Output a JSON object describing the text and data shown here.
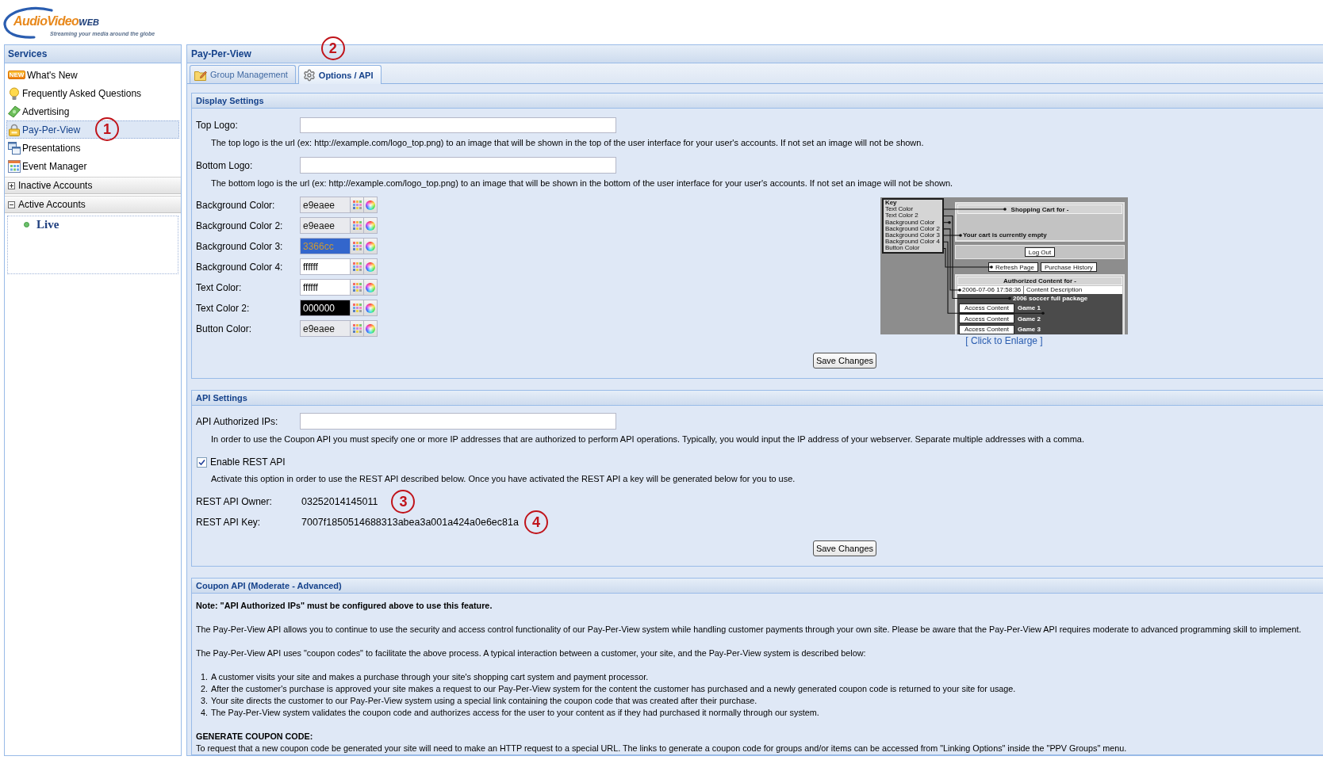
{
  "logo": {
    "name": "AudioVideo",
    "suffix": "WEB",
    "tagline": "Streaming your media around the globe"
  },
  "sidebar": {
    "title": "Services",
    "items": [
      {
        "label": "What's New",
        "badge": "NEW",
        "selected": false
      },
      {
        "label": "Frequently Asked Questions",
        "selected": false
      },
      {
        "label": "Advertising",
        "selected": false
      },
      {
        "label": "Pay-Per-View",
        "selected": true,
        "annotation": "1"
      },
      {
        "label": "Presentations",
        "selected": false
      },
      {
        "label": "Event Manager",
        "selected": false
      }
    ],
    "sections": [
      {
        "label": "Inactive Accounts",
        "expanded": false
      },
      {
        "label": "Active Accounts",
        "expanded": true,
        "children": [
          {
            "label": "Live"
          }
        ]
      }
    ]
  },
  "main": {
    "title": "Pay-Per-View",
    "annotation": "2",
    "tabs": [
      {
        "label": "Group Management",
        "selected": false
      },
      {
        "label": "Options / API",
        "selected": true
      }
    ]
  },
  "display_settings": {
    "title": "Display Settings",
    "fields": [
      {
        "label": "Top Logo:",
        "description": "The top logo is the url (ex: http://example.com/logo_top.png) to an image that will be shown in the top of the user interface for your user's accounts. If not set an image will not be shown."
      },
      {
        "label": "Bottom Logo:",
        "description": "The bottom logo is the url (ex: http://example.com/logo_top.png) to an image that will be shown in the bottom of the user interface for your user's accounts. If not set an image will not be shown."
      }
    ],
    "colors": [
      {
        "label": "Background Color:",
        "value": "e9eaee"
      },
      {
        "label": "Background Color 2:",
        "value": "e9eaee"
      },
      {
        "label": "Background Color 3:",
        "value": "3366cc"
      },
      {
        "label": "Background Color 4:",
        "value": "ffffff"
      },
      {
        "label": "Text Color:",
        "value": "ffffff"
      },
      {
        "label": "Text Color 2:",
        "value": "000000"
      },
      {
        "label": "Button Color:",
        "value": "e9eaee"
      }
    ],
    "preview": {
      "key_title": "Key",
      "key_items": [
        "Text Color",
        "Text Color 2",
        "Background Color",
        "Background Color 2",
        "Background Color 3",
        "Background Color 4",
        "Button Color"
      ],
      "cart_title": "Shopping Cart for -",
      "cart_message": "Your cart is currently empty",
      "logout_button": "Log Out",
      "buttons": [
        "Refresh Page",
        "Purchase History"
      ],
      "content_title": "Authorized Content for -",
      "content_header": [
        "2006-07-06 17:58:36",
        "Content Description"
      ],
      "package": "2006 soccer full package",
      "rows": [
        {
          "button": "Access Content",
          "name": "Game 1"
        },
        {
          "button": "Access Content",
          "name": "Game 2"
        },
        {
          "button": "Access Content",
          "name": "Game 3"
        }
      ]
    },
    "preview_link": "[ Click to Enlarge ]",
    "save_button": "Save Changes"
  },
  "api_settings": {
    "title": "API Settings",
    "ip_field": {
      "label": "API Authorized IPs:",
      "description": "In order to use the Coupon API you must specify one or more IP addresses that are authorized to perform API operations. Typically, you would input the IP address of your webserver. Separate multiple addresses with a comma."
    },
    "enable_rest_api": {
      "label": "Enable REST API",
      "checked": true,
      "description": "Activate this option in order to use the REST API described below. Once you have activated the REST API a key will be generated below for you to use."
    },
    "owner": {
      "label": "REST API Owner:",
      "value": "03252014145011",
      "annotation": "3"
    },
    "key": {
      "label": "REST API Key:",
      "value": "7007f1850514688313abea3a001a424a0e6ec81a",
      "annotation": "4"
    },
    "save_button": "Save Changes"
  },
  "coupon_api": {
    "title": "Coupon API (Moderate - Advanced)",
    "note": "Note: \"API Authorized IPs\" must be configured above to use this feature.",
    "paragraphs": [
      "The Pay-Per-View API allows you to continue to use the security and access control functionality of our Pay-Per-View system while handling customer payments through your own site. Please be aware that the Pay-Per-View API requires moderate to advanced programming skill to implement.",
      "The Pay-Per-View API uses \"coupon codes\" to facilitate the above process. A typical interaction between a customer, your site, and the Pay-Per-View system is described below:"
    ],
    "steps": [
      {
        "number": "1.",
        "text": "A customer visits your site and makes a purchase through your site's shopping cart system and payment processor."
      },
      {
        "number": "2.",
        "text": "After the customer's purchase is approved your site makes a request to our Pay-Per-View system for the content the customer has purchased and a newly generated coupon code is returned to your site for usage."
      },
      {
        "number": "3.",
        "text": "Your site directs the customer to our Pay-Per-View system using a special link containing the coupon code that was created after their purchase."
      },
      {
        "number": "4.",
        "text": "The Pay-Per-View system validates the coupon code and authorizes access for the user to your content as if they had purchased it normally through our system."
      }
    ],
    "subheading": "GENERATE COUPON CODE:",
    "subtext": "To request that a new coupon code be generated your site will need to make an HTTP request to a special URL. The links to generate a coupon code for groups and/or items can be accessed from \"Linking Options\" inside the \"PPV Groups\" menu."
  }
}
